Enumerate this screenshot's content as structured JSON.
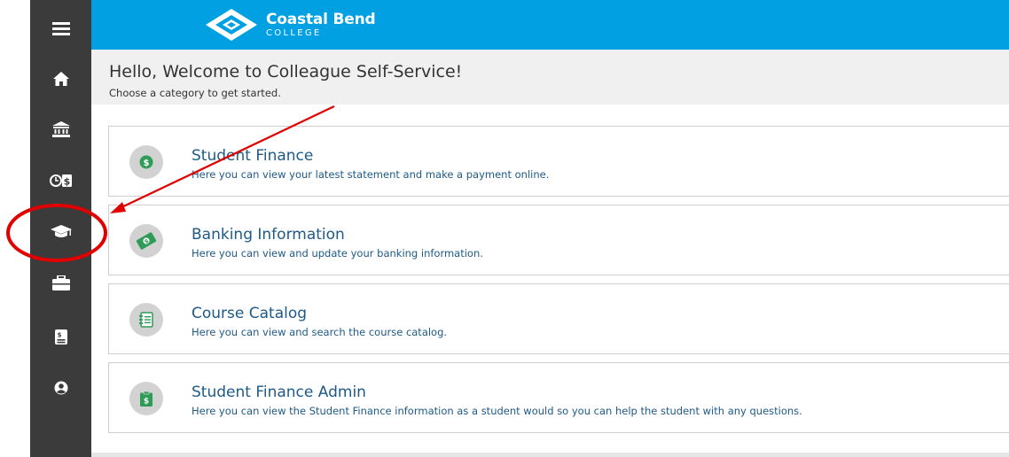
{
  "sidebar": {
    "items": [
      {
        "icon": "menu-icon"
      },
      {
        "icon": "home-icon"
      },
      {
        "icon": "bank-icon"
      },
      {
        "icon": "finance-icon"
      },
      {
        "icon": "graduation-cap-icon"
      },
      {
        "icon": "briefcase-icon"
      },
      {
        "icon": "document-icon"
      },
      {
        "icon": "user-icon"
      }
    ]
  },
  "header": {
    "logo_name": "Coastal Bend",
    "logo_sub": "COLLEGE"
  },
  "welcome": {
    "title": "Hello, Welcome to Colleague Self-Service!",
    "subtitle": "Choose a category to get started."
  },
  "cards": [
    {
      "icon": "dollar-coin-icon",
      "title": "Student Finance",
      "description": "Here you can view your latest statement and make a payment online."
    },
    {
      "icon": "money-icon",
      "title": "Banking Information",
      "description": "Here you can view and update your banking information."
    },
    {
      "icon": "catalog-book-icon",
      "title": "Course Catalog",
      "description": "Here you can view and search the course catalog."
    },
    {
      "icon": "finance-admin-icon",
      "title": "Student Finance Admin",
      "description": "Here you can view the Student Finance information as a student would so you can help the student with any questions."
    }
  ],
  "colors": {
    "header": "#00a0e3",
    "sidebar": "#3b3b3b",
    "link": "#1d5a87",
    "annotation": "#e00000",
    "icon_green": "#2e9b57"
  }
}
